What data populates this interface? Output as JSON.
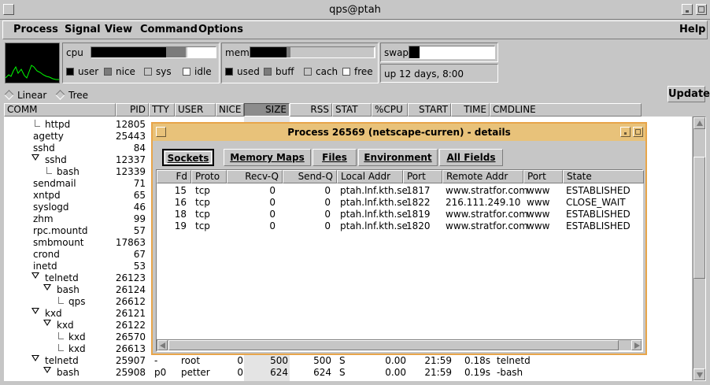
{
  "window": {
    "title": "qps@ptah"
  },
  "menu": {
    "items": [
      "Process",
      "Signal",
      "View",
      "Command",
      "Options"
    ],
    "help": "Help"
  },
  "meters": {
    "cpu": {
      "label": "cpu",
      "legend": [
        "user",
        "nice",
        "sys",
        "idle"
      ],
      "user": 0.6,
      "nice": 0.16,
      "sys": 0.01,
      "idle": 0.23
    },
    "mem": {
      "label": "mem",
      "legend": [
        "used",
        "buff",
        "cach",
        "free"
      ],
      "used": 0.29,
      "buff": 0.03,
      "cach": 0.67,
      "free": 0.01
    },
    "swap": {
      "label": "swap",
      "used": 0.12
    },
    "uptime": "up 12 days,  8:00",
    "colors": {
      "user": "#000000",
      "nice": "#7b7b7b",
      "sys": "#c6c6c6",
      "idle": "#ffffff",
      "graph_line": "#00ff00"
    }
  },
  "view": {
    "linear": "Linear",
    "tree": "Tree",
    "update": "Update"
  },
  "columns": [
    "COMM",
    "PID",
    "TTY",
    "USER",
    "NICE",
    "SIZE",
    "RSS",
    "STAT",
    "%CPU",
    "START",
    "TIME",
    "CMDLINE"
  ],
  "processes": [
    {
      "comm": "httpd",
      "pid": "12805"
    },
    {
      "comm": "agetty",
      "pid": "25443"
    },
    {
      "comm": "sshd",
      "pid": "84"
    },
    {
      "comm": "sshd",
      "pid": "12337"
    },
    {
      "comm": "bash",
      "pid": "12339"
    },
    {
      "comm": "sendmail",
      "pid": "71"
    },
    {
      "comm": "xntpd",
      "pid": "65"
    },
    {
      "comm": "syslogd",
      "pid": "46"
    },
    {
      "comm": "zhm",
      "pid": "99"
    },
    {
      "comm": "rpc.mountd",
      "pid": "57"
    },
    {
      "comm": "smbmount",
      "pid": "17863"
    },
    {
      "comm": "crond",
      "pid": "67"
    },
    {
      "comm": "inetd",
      "pid": "53"
    },
    {
      "comm": "telnetd",
      "pid": "26123"
    },
    {
      "comm": "bash",
      "pid": "26124"
    },
    {
      "comm": "qps",
      "pid": "26612"
    },
    {
      "comm": "kxd",
      "pid": "26121"
    },
    {
      "comm": "kxd",
      "pid": "26122"
    },
    {
      "comm": "kxd",
      "pid": "26570"
    },
    {
      "comm": "kxd",
      "pid": "26613"
    },
    {
      "comm": "telnetd",
      "pid": "25907",
      "tty": "-",
      "user": "root",
      "nice": "0",
      "size": "500",
      "rss": "500",
      "stat": "S",
      "cpu": "0.00",
      "start": "21:59",
      "time": "0.18s",
      "cmd": "telnetd"
    },
    {
      "comm": "bash",
      "pid": "25908",
      "tty": "p0",
      "user": "petter",
      "nice": "0",
      "size": "624",
      "rss": "624",
      "stat": "S",
      "cpu": "0.00",
      "start": "21:59",
      "time": "0.19s",
      "cmd": "-bash"
    }
  ],
  "dialog": {
    "title": "Process 26569 (netscape-curren) - details",
    "tabs": [
      "Sockets",
      "Memory Maps",
      "Files",
      "Environment",
      "All Fields"
    ],
    "columns": [
      "Fd",
      "Proto",
      "Recv-Q",
      "Send-Q",
      "Local Addr",
      "Port",
      "Remote Addr",
      "Port",
      "State"
    ],
    "rows": [
      {
        "fd": "15",
        "proto": "tcp",
        "recv": "0",
        "send": "0",
        "local": "ptah.lnf.kth.se",
        "lport": "1817",
        "remote": "www.stratfor.com",
        "rport": "www",
        "state": "ESTABLISHED"
      },
      {
        "fd": "16",
        "proto": "tcp",
        "recv": "0",
        "send": "0",
        "local": "ptah.lnf.kth.se",
        "lport": "1822",
        "remote": "216.111.249.10",
        "rport": "www",
        "state": "CLOSE_WAIT"
      },
      {
        "fd": "18",
        "proto": "tcp",
        "recv": "0",
        "send": "0",
        "local": "ptah.lnf.kth.se",
        "lport": "1819",
        "remote": "www.stratfor.com",
        "rport": "www",
        "state": "ESTABLISHED"
      },
      {
        "fd": "19",
        "proto": "tcp",
        "recv": "0",
        "send": "0",
        "local": "ptah.lnf.kth.se",
        "lport": "1820",
        "remote": "www.stratfor.com",
        "rport": "www",
        "state": "ESTABLISHED"
      }
    ]
  }
}
